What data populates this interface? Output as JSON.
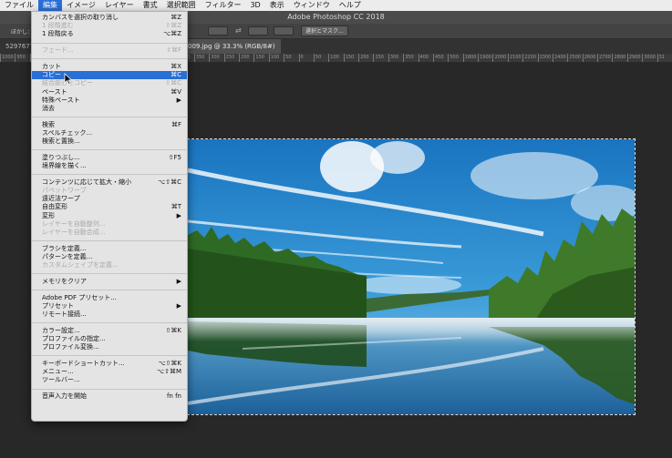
{
  "menubar": {
    "items": [
      "ファイル",
      "編集",
      "イメージ",
      "レイヤー",
      "書式",
      "選択範囲",
      "フィルター",
      "3D",
      "表示",
      "ウィンドウ",
      "ヘルプ"
    ],
    "active_index": 1
  },
  "window": {
    "title": "Adobe Photoshop CC 2018"
  },
  "options": {
    "blur_label": "ぼかし：",
    "select_mask_button": "選択とマスク..."
  },
  "tabs": [
    {
      "label": "5297677.jp"
    },
    {
      "label": "009.jpg @ 33.3% (RGB/8#)"
    }
  ],
  "ruler": {
    "ticks": [
      "1000",
      "950",
      "900",
      "850",
      "800",
      "750",
      "700",
      "650",
      "600",
      "550",
      "500",
      "450",
      "400",
      "350",
      "300",
      "250",
      "200",
      "150",
      "100",
      "50",
      "0",
      "50",
      "100",
      "150",
      "200",
      "250",
      "300",
      "350",
      "400",
      "450",
      "500",
      "1800",
      "1900",
      "2000",
      "2100",
      "2200",
      "2300",
      "2400",
      "2500",
      "2600",
      "2700",
      "2800",
      "2900",
      "3000",
      "31"
    ]
  },
  "edit_menu": {
    "items": [
      {
        "label": "カンバスを選択の取り消し",
        "shortcut": "⌘Z",
        "disabled": false
      },
      {
        "label": "1 段階進む",
        "shortcut": "⇧⌘Z",
        "disabled": true
      },
      {
        "label": "1 段階戻る",
        "shortcut": "⌥⌘Z",
        "disabled": false
      },
      {
        "sep": true
      },
      {
        "label": "フェード...",
        "shortcut": "⇧⌘F",
        "disabled": true
      },
      {
        "sep": true
      },
      {
        "label": "カット",
        "shortcut": "⌘X",
        "disabled": false
      },
      {
        "label": "コピー",
        "shortcut": "⌘C",
        "disabled": false,
        "selected": true
      },
      {
        "label": "結合部分をコピー",
        "shortcut": "⇧⌘C",
        "disabled": true
      },
      {
        "label": "ペースト",
        "shortcut": "⌘V",
        "disabled": false
      },
      {
        "label": "特殊ペースト",
        "shortcut": "▶",
        "disabled": false
      },
      {
        "label": "消去",
        "shortcut": "",
        "disabled": false
      },
      {
        "sep": true
      },
      {
        "label": "検索",
        "shortcut": "⌘F",
        "disabled": false
      },
      {
        "label": "スペルチェック...",
        "shortcut": "",
        "disabled": false
      },
      {
        "label": "検索と置換...",
        "shortcut": "",
        "disabled": false
      },
      {
        "sep": true
      },
      {
        "label": "塗りつぶし...",
        "shortcut": "⇧F5",
        "disabled": false
      },
      {
        "label": "境界線を描く...",
        "shortcut": "",
        "disabled": false
      },
      {
        "sep": true
      },
      {
        "label": "コンテンツに応じて拡大・縮小",
        "shortcut": "⌥⇧⌘C",
        "disabled": false
      },
      {
        "label": "パペットワープ",
        "shortcut": "",
        "disabled": true
      },
      {
        "label": "遠近法ワープ",
        "shortcut": "",
        "disabled": false
      },
      {
        "label": "自由変形",
        "shortcut": "⌘T",
        "disabled": false
      },
      {
        "label": "変形",
        "shortcut": "▶",
        "disabled": false
      },
      {
        "label": "レイヤーを自動整列...",
        "shortcut": "",
        "disabled": true
      },
      {
        "label": "レイヤーを自動合成...",
        "shortcut": "",
        "disabled": true
      },
      {
        "sep": true
      },
      {
        "label": "ブラシを定義...",
        "shortcut": "",
        "disabled": false
      },
      {
        "label": "パターンを定義...",
        "shortcut": "",
        "disabled": false
      },
      {
        "label": "カスタムシェイプを定義...",
        "shortcut": "",
        "disabled": true
      },
      {
        "sep": true
      },
      {
        "label": "メモリをクリア",
        "shortcut": "▶",
        "disabled": false
      },
      {
        "sep": true
      },
      {
        "label": "Adobe PDF プリセット...",
        "shortcut": "",
        "disabled": false
      },
      {
        "label": "プリセット",
        "shortcut": "▶",
        "disabled": false
      },
      {
        "label": "リモート接続...",
        "shortcut": "",
        "disabled": false
      },
      {
        "sep": true
      },
      {
        "label": "カラー設定...",
        "shortcut": "⇧⌘K",
        "disabled": false
      },
      {
        "label": "プロファイルの指定...",
        "shortcut": "",
        "disabled": false
      },
      {
        "label": "プロファイル変換...",
        "shortcut": "",
        "disabled": false
      },
      {
        "sep": true
      },
      {
        "label": "キーボードショートカット...",
        "shortcut": "⌥⇧⌘K",
        "disabled": false
      },
      {
        "label": "メニュー...",
        "shortcut": "⌥⇧⌘M",
        "disabled": false
      },
      {
        "label": "ツールバー...",
        "shortcut": "",
        "disabled": false
      },
      {
        "sep": true
      },
      {
        "label": "音声入力を開始",
        "shortcut": "fn fn",
        "disabled": false
      }
    ]
  },
  "colors": {
    "menu_highlight": "#2a6fd6",
    "app_background": "#282828",
    "menu_background": "#e4e4e4"
  }
}
